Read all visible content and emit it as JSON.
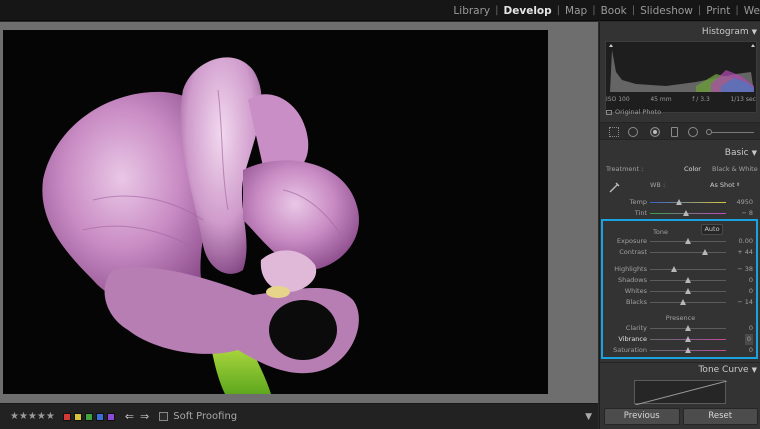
{
  "modules": [
    "Library",
    "Develop",
    "Map",
    "Book",
    "Slideshow",
    "Print",
    "We"
  ],
  "active_module": "Develop",
  "panel": {
    "histogram_title": "Histogram",
    "histogram_info": [
      "ISO 100",
      "45 mm",
      "f / 3.3",
      "1/13 sec"
    ],
    "original_photo_label": "Original Photo",
    "basic_title": "Basic",
    "treatment_label": "Treatment :",
    "treatment_options": [
      "Color",
      "Black & White"
    ],
    "wb_label": "WB :",
    "wb_value": "As Shot",
    "wb_sliders": [
      {
        "label": "Temp",
        "value": "4950",
        "pos": 0.38
      },
      {
        "label": "Tint",
        "value": "− 8",
        "pos": 0.48
      }
    ],
    "tone_label": "Tone",
    "auto_label": "Auto",
    "tone_sliders": [
      {
        "label": "Exposure",
        "value": "0.00",
        "pos": 0.5
      },
      {
        "label": "Contrast",
        "value": "+ 44",
        "pos": 0.72
      },
      {
        "label": "Highlights",
        "value": "− 38",
        "pos": 0.31
      },
      {
        "label": "Shadows",
        "value": "0",
        "pos": 0.5
      },
      {
        "label": "Whites",
        "value": "0",
        "pos": 0.5
      },
      {
        "label": "Blacks",
        "value": "− 14",
        "pos": 0.43
      }
    ],
    "presence_label": "Presence",
    "presence_sliders": [
      {
        "label": "Clarity",
        "value": "0",
        "pos": 0.5
      },
      {
        "label": "Vibrance",
        "value": "0",
        "pos": 0.5
      },
      {
        "label": "Saturation",
        "value": "0",
        "pos": 0.5
      }
    ],
    "tone_curve_title": "Tone Curve",
    "previous_label": "Previous",
    "reset_label": "Reset"
  },
  "toolbar": {
    "stars": "★★★★★",
    "color_labels": [
      "#d23a3a",
      "#d6c53a",
      "#3fa53f",
      "#3a6fd6",
      "#8a4ad6"
    ],
    "soft_proofing_label": "Soft Proofing"
  },
  "colors": {
    "accent": "#1aa3e3",
    "panel_bg": "#333333",
    "background": "#6e6e6e"
  }
}
